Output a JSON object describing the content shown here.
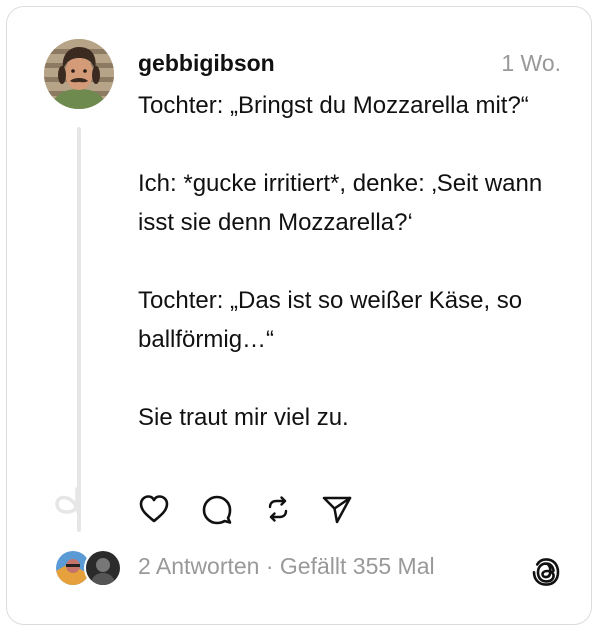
{
  "post": {
    "username": "gebbigibson",
    "timestamp": "1 Wo.",
    "paragraphs": [
      "Tochter: „Bringst du Mozzarella mit?“",
      "Ich: *gucke irritiert*, denke: ‚Seit wann isst sie denn Mozzarella?‘",
      "Tochter: „Das ist so weißer Käse, so ballförmig…“",
      "Sie traut mir viel zu."
    ]
  },
  "actions": {
    "like_icon": "heart-icon",
    "reply_icon": "comment-icon",
    "repost_icon": "repost-icon",
    "share_icon": "send-icon"
  },
  "footer": {
    "replies": "2 Antworten",
    "separator": " · ",
    "likes": "Gefällt 355 Mal",
    "logo_icon": "threads-logo-icon"
  },
  "colors": {
    "text": "#111111",
    "muted": "#999999",
    "border": "#dcdcdc",
    "thread_line": "#e6e6e6"
  }
}
